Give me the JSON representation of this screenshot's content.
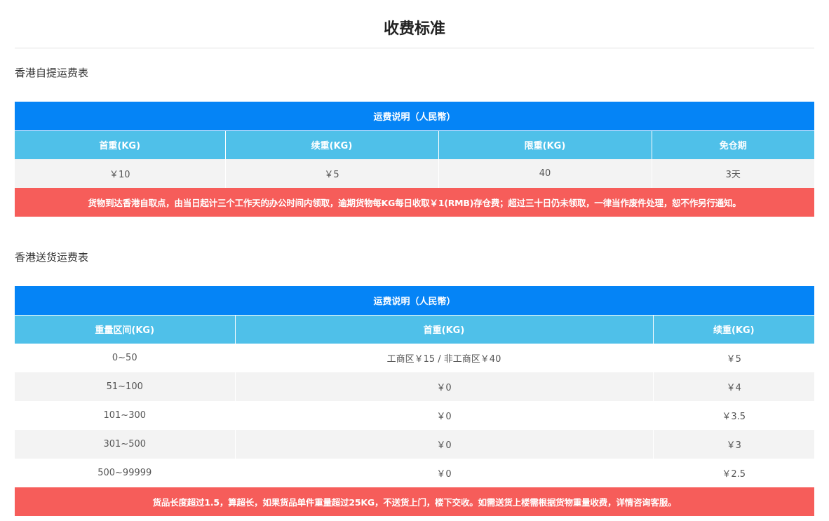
{
  "page": {
    "title": "收费标准"
  },
  "pickup": {
    "heading": "香港自提运费表",
    "caption": "运费说明（人民幣）",
    "columns": [
      "首重(KG)",
      "续重(KG)",
      "限重(KG)",
      "免仓期"
    ],
    "row": [
      "￥10",
      "￥5",
      "40",
      "3天"
    ],
    "note": "货物到达香港自取点，由当日起计三个工作天的办公时间内领取，逾期货物每KG每日收取￥1(RMB)存仓费；超过三十日仍未领取，一律当作废件处理，恕不作另行通知。"
  },
  "delivery": {
    "heading": "香港送货运费表",
    "caption": "运费说明（人民幣）",
    "columns": [
      "重量区间(KG)",
      "首重(KG)",
      "续重(KG)"
    ],
    "rows": [
      [
        "0~50",
        "工商区￥15 / 非工商区￥40",
        "￥5"
      ],
      [
        "51~100",
        "￥0",
        "￥4"
      ],
      [
        "101~300",
        "￥0",
        "￥3.5"
      ],
      [
        "301~500",
        "￥0",
        "￥3"
      ],
      [
        "500~99999",
        "￥0",
        "￥2.5"
      ]
    ],
    "note": "货品长度超过1.5，算超长，如果货品单件重量超过25KG，不送货上门，楼下交收。如需送货上楼需根据货物重量收费，详情咨询客服。"
  },
  "colors": {
    "caption_bg": "#0584f6",
    "header_bg": "#4fc0e9",
    "note_bg": "#f65d5a",
    "stripe_bg": "#f3f3f3"
  }
}
